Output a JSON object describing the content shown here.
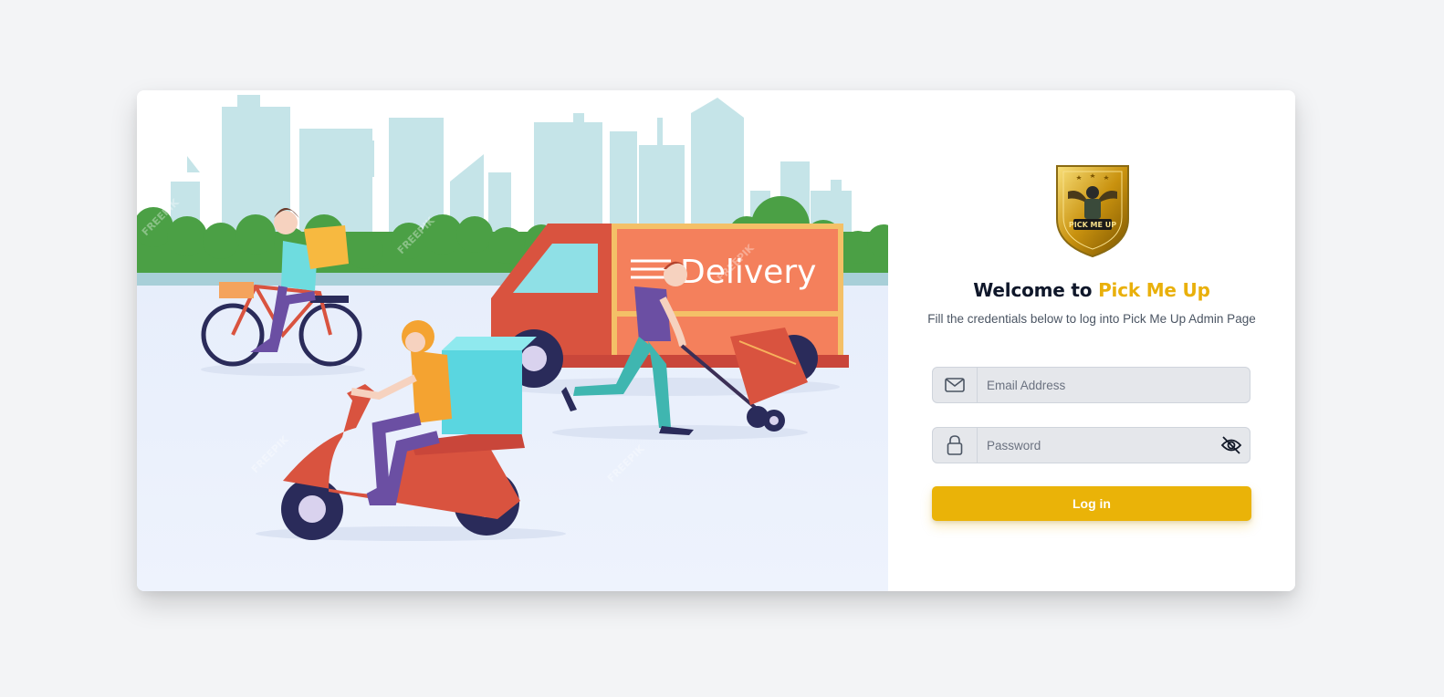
{
  "login": {
    "title_prefix": "Welcome to ",
    "title_brand": "Pick Me Up",
    "subtitle": "Fill the credentials below to log into Pick Me Up Admin Page",
    "email_placeholder": "Email Address",
    "email_value": "",
    "password_placeholder": "Password",
    "password_value": "",
    "login_button": "Log in"
  },
  "logo": {
    "text": "PICK ME UP"
  },
  "hero": {
    "truck_label": "Delivery",
    "watermark": "FREEPIK"
  },
  "icons": {
    "email": "envelope-icon",
    "password": "lock-icon",
    "toggle": "eye-off-icon"
  },
  "colors": {
    "page_bg": "#f3f4f6",
    "brand_yellow": "#eab308",
    "title_dark": "#0f172a",
    "input_bg": "#e5e7eb"
  }
}
